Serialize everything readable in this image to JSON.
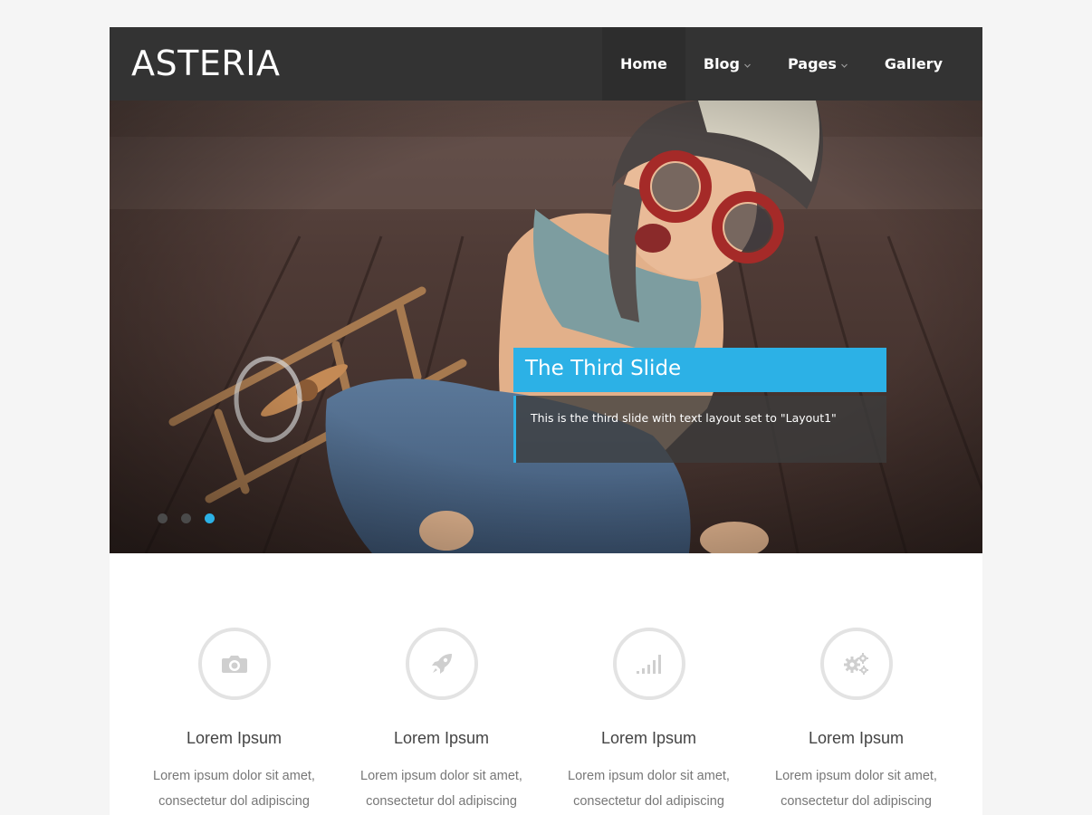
{
  "site": {
    "logo": "ASTERIA"
  },
  "nav": {
    "items": [
      {
        "label": "Home"
      },
      {
        "label": "Blog"
      },
      {
        "label": "Pages"
      },
      {
        "label": "Gallery"
      }
    ]
  },
  "slider": {
    "caption_title": "The Third Slide",
    "caption_text": "This is the third slide with text layout set to \"Layout1\"",
    "active_slide": 3,
    "slide_count": 3
  },
  "features": [
    {
      "icon": "camera-icon",
      "title": "Lorem Ipsum",
      "text_line1": "Lorem ipsum dolor sit amet,",
      "text_line2": "consectetur dol adipiscing"
    },
    {
      "icon": "rocket-icon",
      "title": "Lorem Ipsum",
      "text_line1": "Lorem ipsum dolor sit amet,",
      "text_line2": "consectetur dol adipiscing"
    },
    {
      "icon": "signal-icon",
      "title": "Lorem Ipsum",
      "text_line1": "Lorem ipsum dolor sit amet,",
      "text_line2": "consectetur dol adipiscing"
    },
    {
      "icon": "gears-icon",
      "title": "Lorem Ipsum",
      "text_line1": "Lorem ipsum dolor sit amet,",
      "text_line2": "consectetur dol adipiscing"
    }
  ],
  "colors": {
    "accent": "#2cb1e6",
    "header_bg": "#333333",
    "page_bg": "#f5f5f5"
  }
}
